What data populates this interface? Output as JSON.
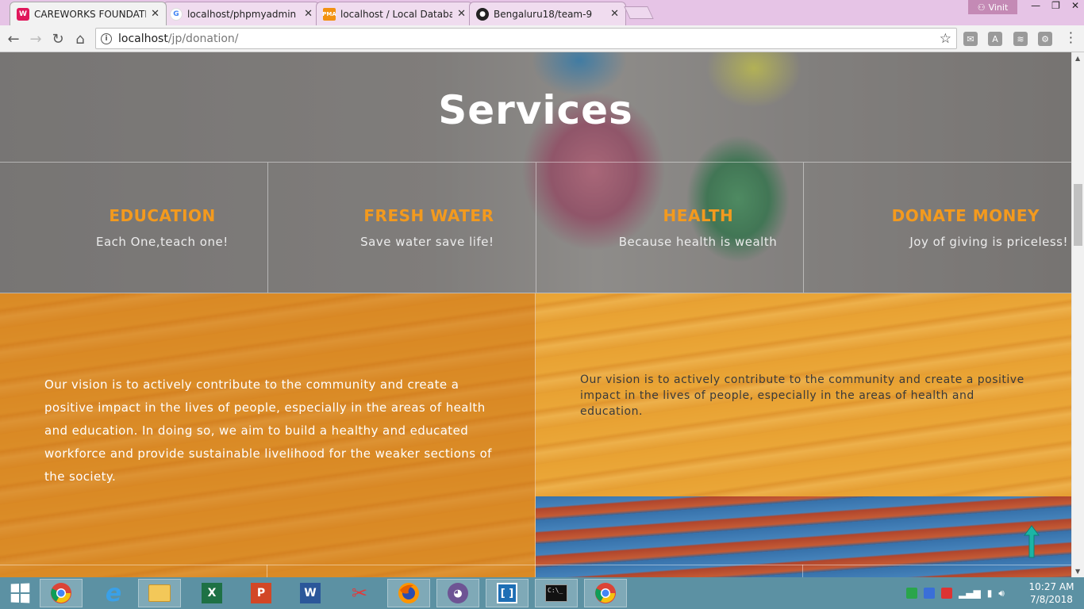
{
  "browser": {
    "tabs": [
      {
        "title": "CAREWORKS FOUNDATIC",
        "favicon": "careworks-favicon",
        "color": "#e0185b",
        "active": true
      },
      {
        "title": "localhost/phpmyadmin -",
        "favicon": "google-favicon",
        "color": "#4285f4",
        "active": false
      },
      {
        "title": "localhost / Local Databas",
        "favicon": "phpmyadmin-favicon",
        "color": "#f29111",
        "active": false
      },
      {
        "title": "Bengaluru18/team-9",
        "favicon": "github-favicon",
        "color": "#222222",
        "active": false
      }
    ],
    "profile_name": "Vinit",
    "url_host": "localhost",
    "url_path": "/jp/donation/"
  },
  "page": {
    "title": "Services",
    "services": [
      {
        "heading": "EDUCATION",
        "tagline": "Each One,teach one!"
      },
      {
        "heading": "FRESH WATER",
        "tagline": "Save water save life!"
      },
      {
        "heading": "HEALTH",
        "tagline": "Because health is wealth"
      },
      {
        "heading": "DONATE MONEY",
        "tagline": "Joy of giving is priceless!"
      }
    ],
    "vision_left": "Our vision is to actively contribute to the community and create a positive impact in the lives of people, especially in the areas of health and education. In doing so, we aim to build a healthy and educated workforce and provide sustainable livelihood for the weaker sections of the society.",
    "vision_right": "Our vision is to actively contribute to the community and create a positive impact in the lives of people, especially in the areas of health and education.",
    "accent_color": "#f39a1e"
  },
  "taskbar": {
    "apps": [
      {
        "name": "chrome",
        "open": true
      },
      {
        "name": "internet-explorer",
        "open": false
      },
      {
        "name": "file-explorer",
        "open": true
      },
      {
        "name": "excel",
        "open": false
      },
      {
        "name": "powerpoint",
        "open": false
      },
      {
        "name": "word",
        "open": false
      },
      {
        "name": "snipping-tool",
        "open": false
      },
      {
        "name": "firefox",
        "open": true
      },
      {
        "name": "github-desktop",
        "open": true
      },
      {
        "name": "brackets",
        "open": true
      },
      {
        "name": "command-prompt",
        "open": true
      },
      {
        "name": "chrome-2",
        "open": true
      }
    ],
    "time": "10:27 AM",
    "date": "7/8/2018"
  }
}
